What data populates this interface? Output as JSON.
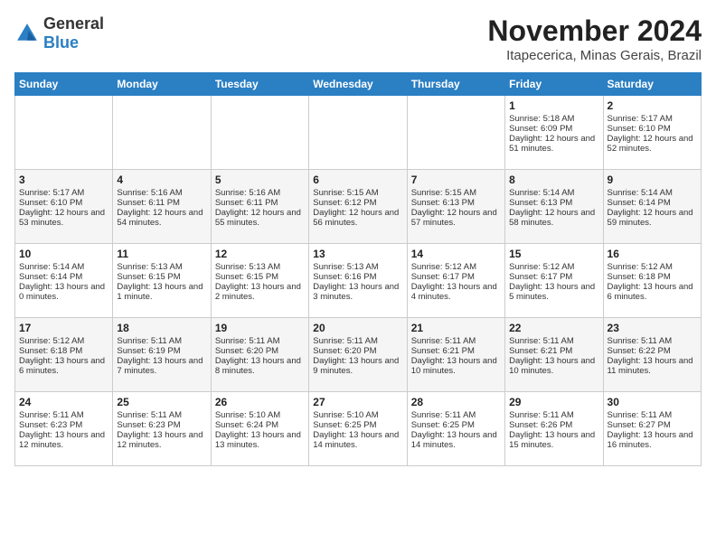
{
  "logo": {
    "general": "General",
    "blue": "Blue"
  },
  "header": {
    "month": "November 2024",
    "location": "Itapecerica, Minas Gerais, Brazil"
  },
  "weekdays": [
    "Sunday",
    "Monday",
    "Tuesday",
    "Wednesday",
    "Thursday",
    "Friday",
    "Saturday"
  ],
  "weeks": [
    [
      {
        "day": "",
        "info": ""
      },
      {
        "day": "",
        "info": ""
      },
      {
        "day": "",
        "info": ""
      },
      {
        "day": "",
        "info": ""
      },
      {
        "day": "",
        "info": ""
      },
      {
        "day": "1",
        "info": "Sunrise: 5:18 AM\nSunset: 6:09 PM\nDaylight: 12 hours and 51 minutes."
      },
      {
        "day": "2",
        "info": "Sunrise: 5:17 AM\nSunset: 6:10 PM\nDaylight: 12 hours and 52 minutes."
      }
    ],
    [
      {
        "day": "3",
        "info": "Sunrise: 5:17 AM\nSunset: 6:10 PM\nDaylight: 12 hours and 53 minutes."
      },
      {
        "day": "4",
        "info": "Sunrise: 5:16 AM\nSunset: 6:11 PM\nDaylight: 12 hours and 54 minutes."
      },
      {
        "day": "5",
        "info": "Sunrise: 5:16 AM\nSunset: 6:11 PM\nDaylight: 12 hours and 55 minutes."
      },
      {
        "day": "6",
        "info": "Sunrise: 5:15 AM\nSunset: 6:12 PM\nDaylight: 12 hours and 56 minutes."
      },
      {
        "day": "7",
        "info": "Sunrise: 5:15 AM\nSunset: 6:13 PM\nDaylight: 12 hours and 57 minutes."
      },
      {
        "day": "8",
        "info": "Sunrise: 5:14 AM\nSunset: 6:13 PM\nDaylight: 12 hours and 58 minutes."
      },
      {
        "day": "9",
        "info": "Sunrise: 5:14 AM\nSunset: 6:14 PM\nDaylight: 12 hours and 59 minutes."
      }
    ],
    [
      {
        "day": "10",
        "info": "Sunrise: 5:14 AM\nSunset: 6:14 PM\nDaylight: 13 hours and 0 minutes."
      },
      {
        "day": "11",
        "info": "Sunrise: 5:13 AM\nSunset: 6:15 PM\nDaylight: 13 hours and 1 minute."
      },
      {
        "day": "12",
        "info": "Sunrise: 5:13 AM\nSunset: 6:15 PM\nDaylight: 13 hours and 2 minutes."
      },
      {
        "day": "13",
        "info": "Sunrise: 5:13 AM\nSunset: 6:16 PM\nDaylight: 13 hours and 3 minutes."
      },
      {
        "day": "14",
        "info": "Sunrise: 5:12 AM\nSunset: 6:17 PM\nDaylight: 13 hours and 4 minutes."
      },
      {
        "day": "15",
        "info": "Sunrise: 5:12 AM\nSunset: 6:17 PM\nDaylight: 13 hours and 5 minutes."
      },
      {
        "day": "16",
        "info": "Sunrise: 5:12 AM\nSunset: 6:18 PM\nDaylight: 13 hours and 6 minutes."
      }
    ],
    [
      {
        "day": "17",
        "info": "Sunrise: 5:12 AM\nSunset: 6:18 PM\nDaylight: 13 hours and 6 minutes."
      },
      {
        "day": "18",
        "info": "Sunrise: 5:11 AM\nSunset: 6:19 PM\nDaylight: 13 hours and 7 minutes."
      },
      {
        "day": "19",
        "info": "Sunrise: 5:11 AM\nSunset: 6:20 PM\nDaylight: 13 hours and 8 minutes."
      },
      {
        "day": "20",
        "info": "Sunrise: 5:11 AM\nSunset: 6:20 PM\nDaylight: 13 hours and 9 minutes."
      },
      {
        "day": "21",
        "info": "Sunrise: 5:11 AM\nSunset: 6:21 PM\nDaylight: 13 hours and 10 minutes."
      },
      {
        "day": "22",
        "info": "Sunrise: 5:11 AM\nSunset: 6:21 PM\nDaylight: 13 hours and 10 minutes."
      },
      {
        "day": "23",
        "info": "Sunrise: 5:11 AM\nSunset: 6:22 PM\nDaylight: 13 hours and 11 minutes."
      }
    ],
    [
      {
        "day": "24",
        "info": "Sunrise: 5:11 AM\nSunset: 6:23 PM\nDaylight: 13 hours and 12 minutes."
      },
      {
        "day": "25",
        "info": "Sunrise: 5:11 AM\nSunset: 6:23 PM\nDaylight: 13 hours and 12 minutes."
      },
      {
        "day": "26",
        "info": "Sunrise: 5:10 AM\nSunset: 6:24 PM\nDaylight: 13 hours and 13 minutes."
      },
      {
        "day": "27",
        "info": "Sunrise: 5:10 AM\nSunset: 6:25 PM\nDaylight: 13 hours and 14 minutes."
      },
      {
        "day": "28",
        "info": "Sunrise: 5:11 AM\nSunset: 6:25 PM\nDaylight: 13 hours and 14 minutes."
      },
      {
        "day": "29",
        "info": "Sunrise: 5:11 AM\nSunset: 6:26 PM\nDaylight: 13 hours and 15 minutes."
      },
      {
        "day": "30",
        "info": "Sunrise: 5:11 AM\nSunset: 6:27 PM\nDaylight: 13 hours and 16 minutes."
      }
    ]
  ]
}
